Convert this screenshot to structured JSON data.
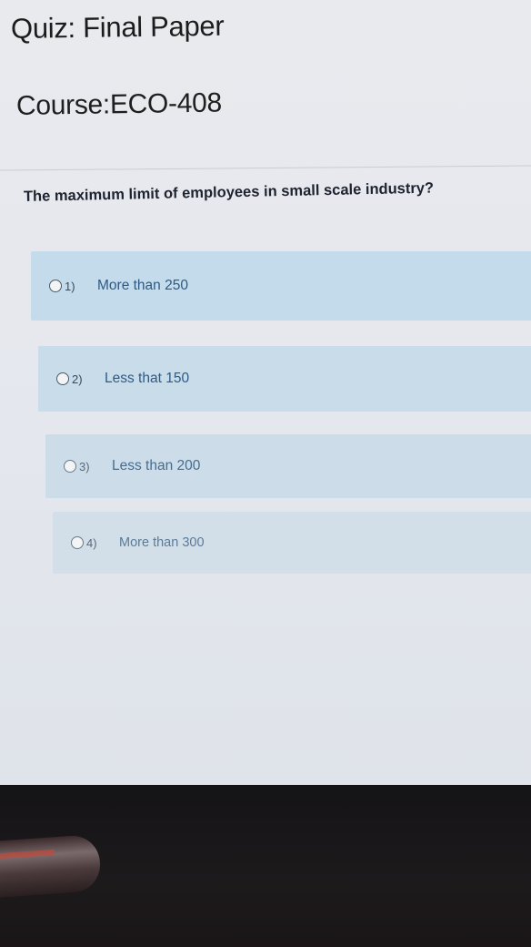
{
  "quiz": {
    "title": "Quiz: Final Paper",
    "course": "Course:ECO-408"
  },
  "question": {
    "text": "The maximum limit of employees in small scale industry?",
    "options": [
      {
        "number": "1)",
        "label": "More than 250"
      },
      {
        "number": "2)",
        "label": "Less that 150"
      },
      {
        "number": "3)",
        "label": "Less than 200"
      },
      {
        "number": "4)",
        "label": "More than 300"
      }
    ]
  },
  "colors": {
    "option_background": "#c9dfee",
    "option_text": "#2e5a84",
    "page_background": "#e8e9ee"
  }
}
